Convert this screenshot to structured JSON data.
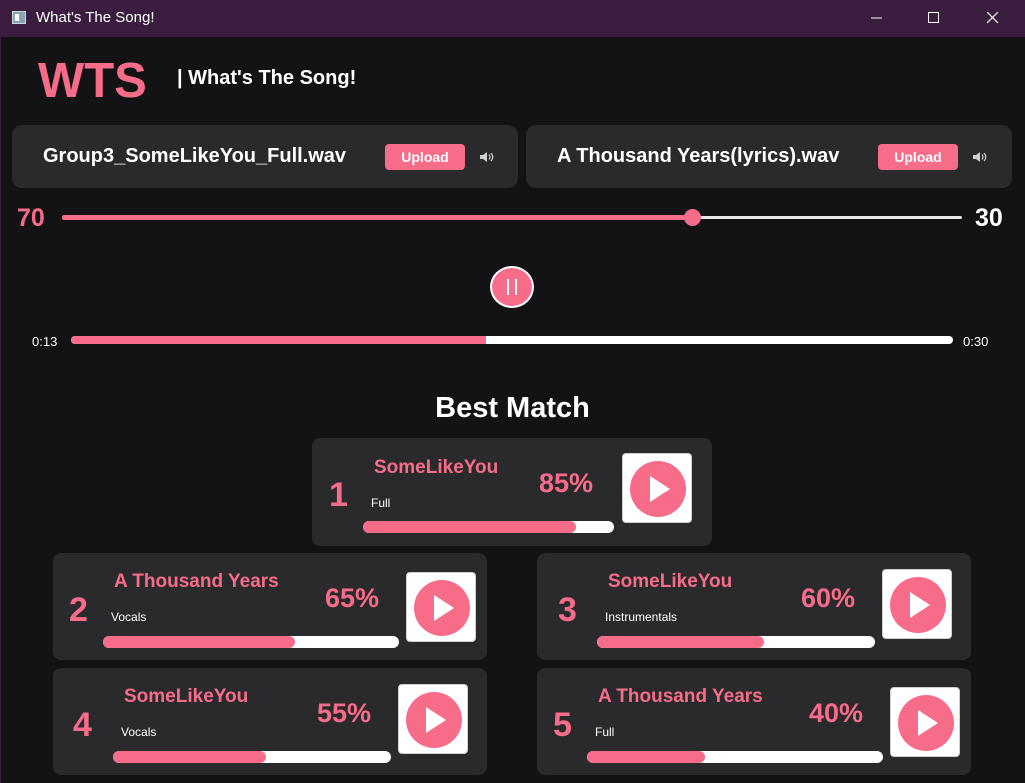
{
  "window": {
    "title": "What's The Song!"
  },
  "header": {
    "logo": "WTS",
    "tagline": "| What's The Song!"
  },
  "files": [
    {
      "name": "Group3_SomeLikeYou_Full.wav",
      "upload_label": "Upload",
      "icon": "speaker-icon"
    },
    {
      "name": "A Thousand Years(lyrics).wav",
      "upload_label": "Upload",
      "icon": "speaker-icon"
    }
  ],
  "mix": {
    "left_value": "70",
    "right_value": "30",
    "position_fraction": 0.7
  },
  "player": {
    "state": "playing",
    "current_time": "0:13",
    "total_time": "0:30",
    "progress_fraction": 0.47
  },
  "results": {
    "title": "Best Match",
    "matches": [
      {
        "rank": "1",
        "song": "SomeLikeYou",
        "variant": "Full",
        "score": "85%",
        "score_value": 85
      },
      {
        "rank": "2",
        "song": "A Thousand Years",
        "variant": "Vocals",
        "score": "65%",
        "score_value": 65
      },
      {
        "rank": "3",
        "song": "SomeLikeYou",
        "variant": "Instrumentals",
        "score": "60%",
        "score_value": 60
      },
      {
        "rank": "4",
        "song": "SomeLikeYou",
        "variant": "Vocals",
        "score": "55%",
        "score_value": 55
      },
      {
        "rank": "5",
        "song": "A Thousand Years",
        "variant": "Full",
        "score": "40%",
        "score_value": 40
      }
    ]
  },
  "colors": {
    "accent": "#f76d89",
    "background": "#131315",
    "card": "#2a2a2d",
    "titlebar": "#3a1d3f"
  }
}
